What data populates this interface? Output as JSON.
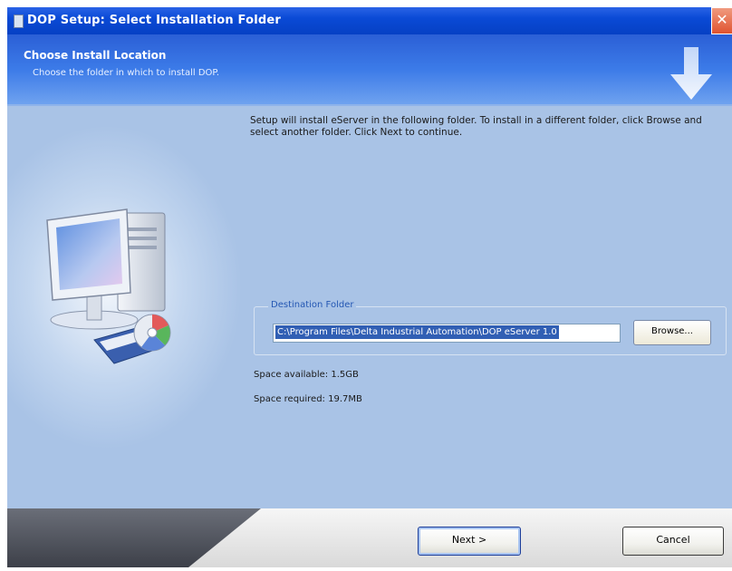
{
  "window": {
    "title": "DOP Setup: Select Installation Folder",
    "close_icon": "close-icon"
  },
  "header": {
    "title": "Choose Install Location",
    "subtitle": "Choose the folder in which to install DOP."
  },
  "main": {
    "intro_text": "Setup will install eServer in the following folder. To install in a different folder, click Browse and select another folder. Click Next to continue.",
    "destination": {
      "label": "Destination Folder",
      "path": "C:\\Program Files\\Delta Industrial Automation\\DOP eServer 1.0",
      "browse_label": "Browse..."
    },
    "space_available": "Space available: 1.5GB",
    "space_required": "Space required: 19.7MB"
  },
  "footer": {
    "next_label": "Next >",
    "cancel_label": "Cancel"
  },
  "colors": {
    "titlebar": "#0a4ad6",
    "body": "#a9c3e6",
    "accent": "#315fb4"
  }
}
